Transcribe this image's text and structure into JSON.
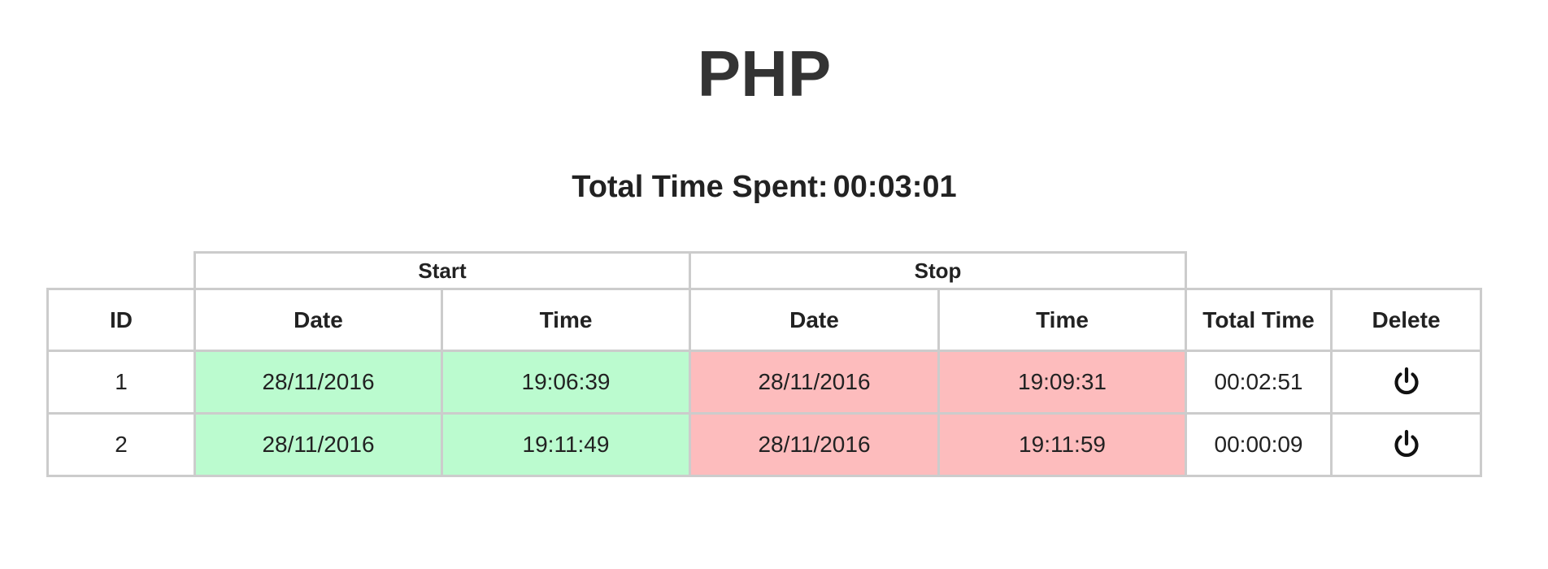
{
  "page": {
    "title": "PHP",
    "total_label": "Total Time Spent:",
    "total_value": "00:03:01"
  },
  "table": {
    "groups": {
      "start": "Start",
      "stop": "Stop"
    },
    "headers": {
      "id": "ID",
      "start_date": "Date",
      "start_time": "Time",
      "stop_date": "Date",
      "stop_time": "Time",
      "total_time": "Total Time",
      "delete": "Delete"
    },
    "rows": [
      {
        "id": "1",
        "start_date": "28/11/2016",
        "start_time": "19:06:39",
        "stop_date": "28/11/2016",
        "stop_time": "19:09:31",
        "total_time": "00:02:51",
        "delete_icon": "power-icon"
      },
      {
        "id": "2",
        "start_date": "28/11/2016",
        "start_time": "19:11:49",
        "stop_date": "28/11/2016",
        "stop_time": "19:11:59",
        "total_time": "00:00:09",
        "delete_icon": "power-icon"
      }
    ]
  },
  "colors": {
    "start_bg": "#bbfbcf",
    "stop_bg": "#fdbcbd",
    "border": "#cccccc",
    "text": "#333333"
  }
}
